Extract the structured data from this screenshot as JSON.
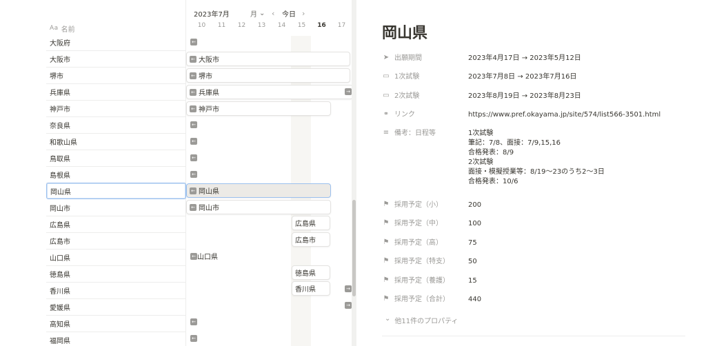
{
  "timeline": {
    "header": {
      "month_label": "2023年7月",
      "view_select": "月",
      "today_label": "今日"
    },
    "name_column_label": "名前",
    "name_column_icon": "Aa",
    "days": [
      "10",
      "11",
      "12",
      "13",
      "14",
      "15",
      "16",
      "17"
    ],
    "today_day": "16",
    "rows": [
      {
        "name": "大阪府"
      },
      {
        "name": "大阪市"
      },
      {
        "name": "堺市"
      },
      {
        "name": "兵庫県"
      },
      {
        "name": "神戸市"
      },
      {
        "name": "奈良県"
      },
      {
        "name": "和歌山県"
      },
      {
        "name": "鳥取県"
      },
      {
        "name": "島根県"
      },
      {
        "name": "岡山県"
      },
      {
        "name": "岡山市"
      },
      {
        "name": "広島県"
      },
      {
        "name": "広島市"
      },
      {
        "name": "山口県"
      },
      {
        "name": "徳島県"
      },
      {
        "name": "香川県"
      },
      {
        "name": "愛媛県"
      },
      {
        "name": "高知県"
      },
      {
        "name": "福岡県"
      }
    ],
    "bars": {
      "osaka_city": "大阪市",
      "sakai": "堺市",
      "hyogo": "兵庫県",
      "kobe": "神戸市",
      "okayama": "岡山県",
      "okayama_city": "岡山市",
      "hiroshima": "広島県",
      "hiroshima_city": "広島市",
      "yamaguchi": "山口県",
      "tokushima": "徳島県",
      "kagawa": "香川県"
    }
  },
  "detail": {
    "title": "岡山県",
    "properties": [
      {
        "icon": "send-icon",
        "glyph": "➤",
        "label": "出願期間",
        "value": "2023年4月17日 → 2023年5月12日"
      },
      {
        "icon": "calendar-icon",
        "glyph": "▭",
        "label": "1次試験",
        "value": "2023年7月8日 → 2023年7月16日"
      },
      {
        "icon": "calendar-icon",
        "glyph": "▭",
        "label": "2次試験",
        "value": "2023年8月19日 → 2023年8月23日"
      },
      {
        "icon": "link-icon",
        "glyph": "⚭",
        "label": "リンク",
        "value": "https://www.pref.okayama.jp/site/574/list566-3501.html"
      }
    ],
    "notes": {
      "label": "備考：日程等",
      "lines": [
        "1次試験",
        "筆記：7/8、面接：7/9,15,16",
        "合格発表：8/9",
        "2次試験",
        "面接・模擬授業等：8/19〜23のうち2〜3日",
        "合格発表：10/6"
      ]
    },
    "numbers": [
      {
        "label": "採用予定（小）",
        "value": "200"
      },
      {
        "label": "採用予定（中）",
        "value": "100"
      },
      {
        "label": "採用予定（高）",
        "value": "75"
      },
      {
        "label": "採用予定（特支）",
        "value": "50"
      },
      {
        "label": "採用予定（養護）",
        "value": "15"
      },
      {
        "label": "採用予定（合計）",
        "value": "440"
      }
    ],
    "more_label": "他11件のプロパティ"
  },
  "colors": {
    "accent_border": "#9bc0ee",
    "today_band": "#f7f6f3",
    "text": "#37352f",
    "muted": "#9b9a97"
  }
}
